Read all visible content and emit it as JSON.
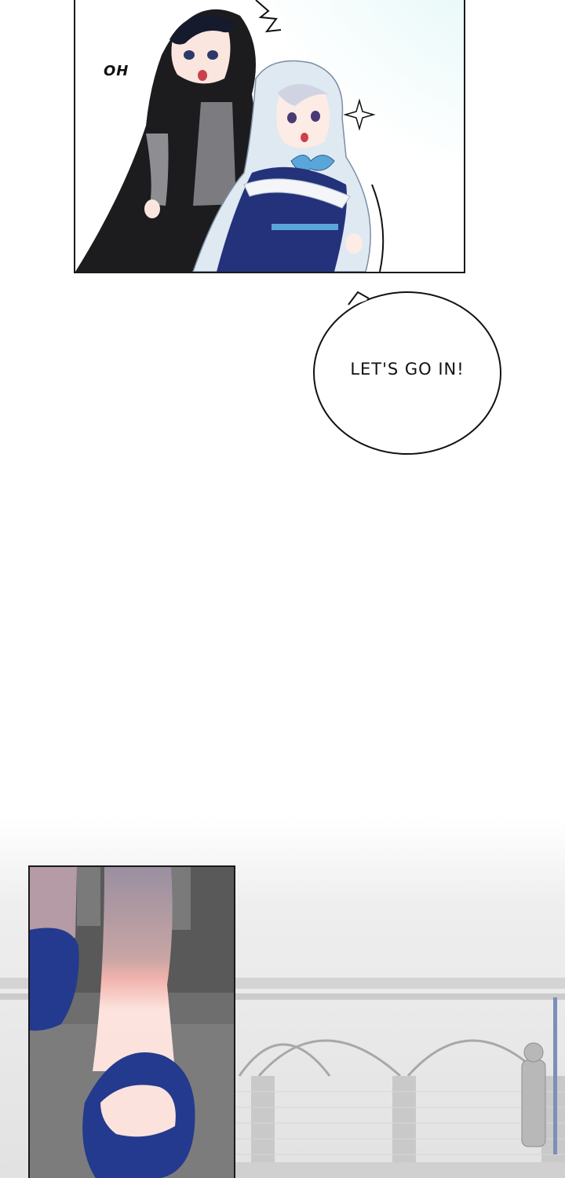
{
  "panels": {
    "top": {
      "sfx_text": "OH"
    },
    "speech_bubble": {
      "text": "LET'S GO IN!"
    }
  },
  "colors": {
    "cloak_black": "#1c1c1e",
    "hood_light_blue": "#dfe9f2",
    "dress_navy": "#23327a",
    "ribbon_blue": "#5aa6da",
    "shoe_blue": "#243a8e",
    "stone_gray": "#b9b9b9"
  }
}
